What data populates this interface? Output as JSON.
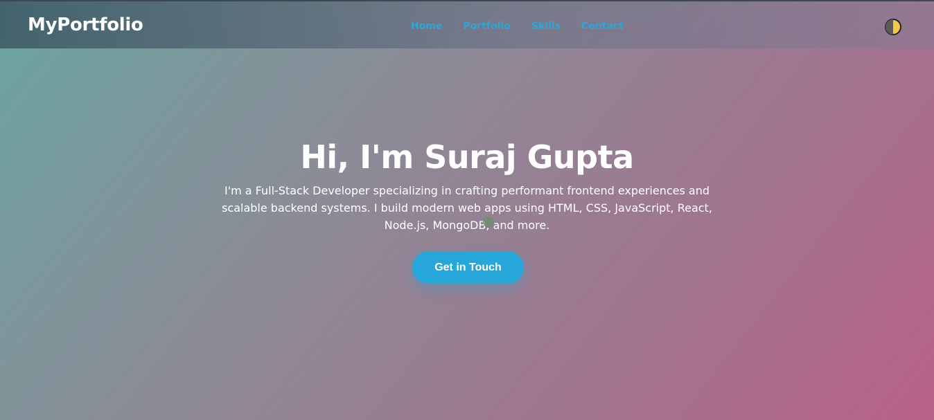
{
  "navbar": {
    "logo": "MyPortfolio",
    "links": [
      {
        "label": "Home"
      },
      {
        "label": "Portfolio"
      },
      {
        "label": "Skills"
      },
      {
        "label": "Contact"
      }
    ],
    "theme_toggle_icon": "half-moon-icon"
  },
  "hero": {
    "title": "Hi, I'm Suraj Gupta",
    "description": "I'm a Full-Stack Developer specializing in crafting performant frontend experiences and scalable backend systems. I build modern web apps using HTML, CSS, JavaScript, React, Node.js, MongoDB, and more.",
    "cta_label": "Get in Touch"
  },
  "colors": {
    "accent": "#26a6d9",
    "nav_link": "#2ea5d6",
    "gradient_start": "#6aa5a0",
    "gradient_end": "#b9628a"
  }
}
